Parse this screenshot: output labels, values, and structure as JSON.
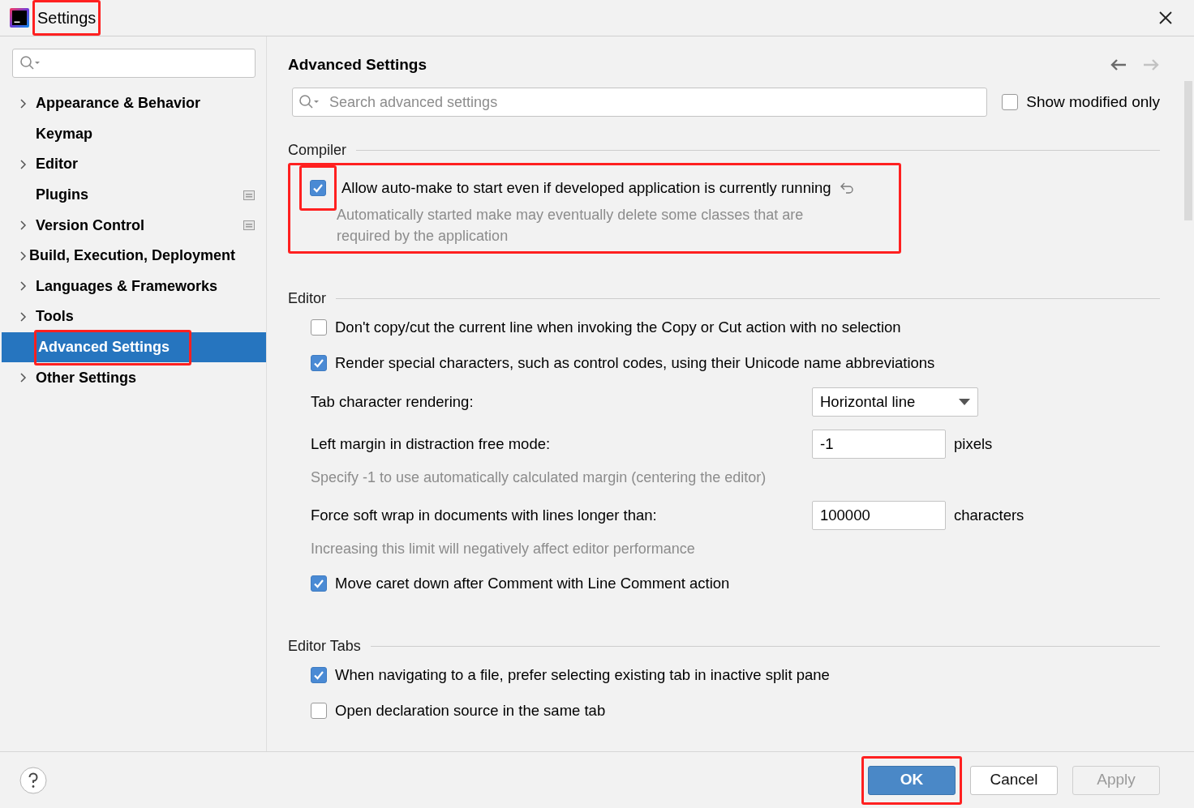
{
  "window": {
    "title": "Settings",
    "title_highlighted": true
  },
  "sidebar": {
    "items": [
      {
        "label": "Appearance & Behavior",
        "expandable": true,
        "selected": false,
        "highlighted": false,
        "scope_icon": false
      },
      {
        "label": "Keymap",
        "expandable": false,
        "selected": false,
        "highlighted": false,
        "scope_icon": false
      },
      {
        "label": "Editor",
        "expandable": true,
        "selected": false,
        "highlighted": false,
        "scope_icon": false
      },
      {
        "label": "Plugins",
        "expandable": false,
        "selected": false,
        "highlighted": false,
        "scope_icon": true
      },
      {
        "label": "Version Control",
        "expandable": true,
        "selected": false,
        "highlighted": false,
        "scope_icon": true
      },
      {
        "label": "Build, Execution, Deployment",
        "expandable": true,
        "selected": false,
        "highlighted": false,
        "scope_icon": false
      },
      {
        "label": "Languages & Frameworks",
        "expandable": true,
        "selected": false,
        "highlighted": false,
        "scope_icon": false
      },
      {
        "label": "Tools",
        "expandable": true,
        "selected": false,
        "highlighted": false,
        "scope_icon": false
      },
      {
        "label": "Advanced Settings",
        "expandable": false,
        "selected": true,
        "highlighted": true,
        "scope_icon": false
      },
      {
        "label": "Other Settings",
        "expandable": true,
        "selected": false,
        "highlighted": false,
        "scope_icon": false
      }
    ]
  },
  "panel": {
    "title": "Advanced Settings",
    "back_enabled": true,
    "forward_enabled": false,
    "search": {
      "placeholder": "Search advanced settings"
    },
    "show_modified": {
      "label": "Show modified only",
      "checked": false
    },
    "sections": [
      {
        "title": "Compiler",
        "options": [
          {
            "kind": "checkbox",
            "label": "Allow auto-make to start even if developed application is currently running",
            "checked": true,
            "modified": true,
            "highlighted": true,
            "checkbox_highlighted": true,
            "description": "Automatically started make may eventually delete some classes that are required by the application"
          }
        ]
      },
      {
        "title": "Editor",
        "options": [
          {
            "kind": "checkbox",
            "label": "Don't copy/cut the current line when invoking the Copy or Cut action with no selection",
            "checked": false,
            "modified": false,
            "highlighted": false,
            "checkbox_highlighted": false
          },
          {
            "kind": "checkbox",
            "label": "Render special characters, such as control codes, using their Unicode name abbreviations",
            "checked": true,
            "modified": false,
            "highlighted": false,
            "checkbox_highlighted": false
          },
          {
            "kind": "dropdown",
            "label": "Tab character rendering:",
            "value": "Horizontal line"
          },
          {
            "kind": "number",
            "label": "Left margin in distraction free mode:",
            "value": "-1",
            "unit": "pixels",
            "description": "Specify -1 to use automatically calculated margin (centering the editor)"
          },
          {
            "kind": "number",
            "label": "Force soft wrap in documents with lines longer than:",
            "value": "100000",
            "unit": "characters",
            "description": "Increasing this limit will negatively affect editor performance"
          },
          {
            "kind": "checkbox",
            "label": "Move caret down after Comment with Line Comment action",
            "checked": true,
            "modified": false,
            "highlighted": false,
            "checkbox_highlighted": false
          }
        ]
      },
      {
        "title": "Editor Tabs",
        "options": [
          {
            "kind": "checkbox",
            "label": "When navigating to a file, prefer selecting existing tab in inactive split pane",
            "checked": true,
            "modified": false,
            "highlighted": false,
            "checkbox_highlighted": false
          },
          {
            "kind": "checkbox",
            "label": "Open declaration source in the same tab",
            "checked": false,
            "modified": false,
            "highlighted": false,
            "checkbox_highlighted": false
          }
        ]
      }
    ]
  },
  "footer": {
    "buttons": [
      {
        "label": "OK",
        "kind": "primary",
        "disabled": false,
        "highlighted": true
      },
      {
        "label": "Cancel",
        "kind": "normal",
        "disabled": false,
        "highlighted": false
      },
      {
        "label": "Apply",
        "kind": "normal",
        "disabled": true,
        "highlighted": false
      }
    ]
  }
}
